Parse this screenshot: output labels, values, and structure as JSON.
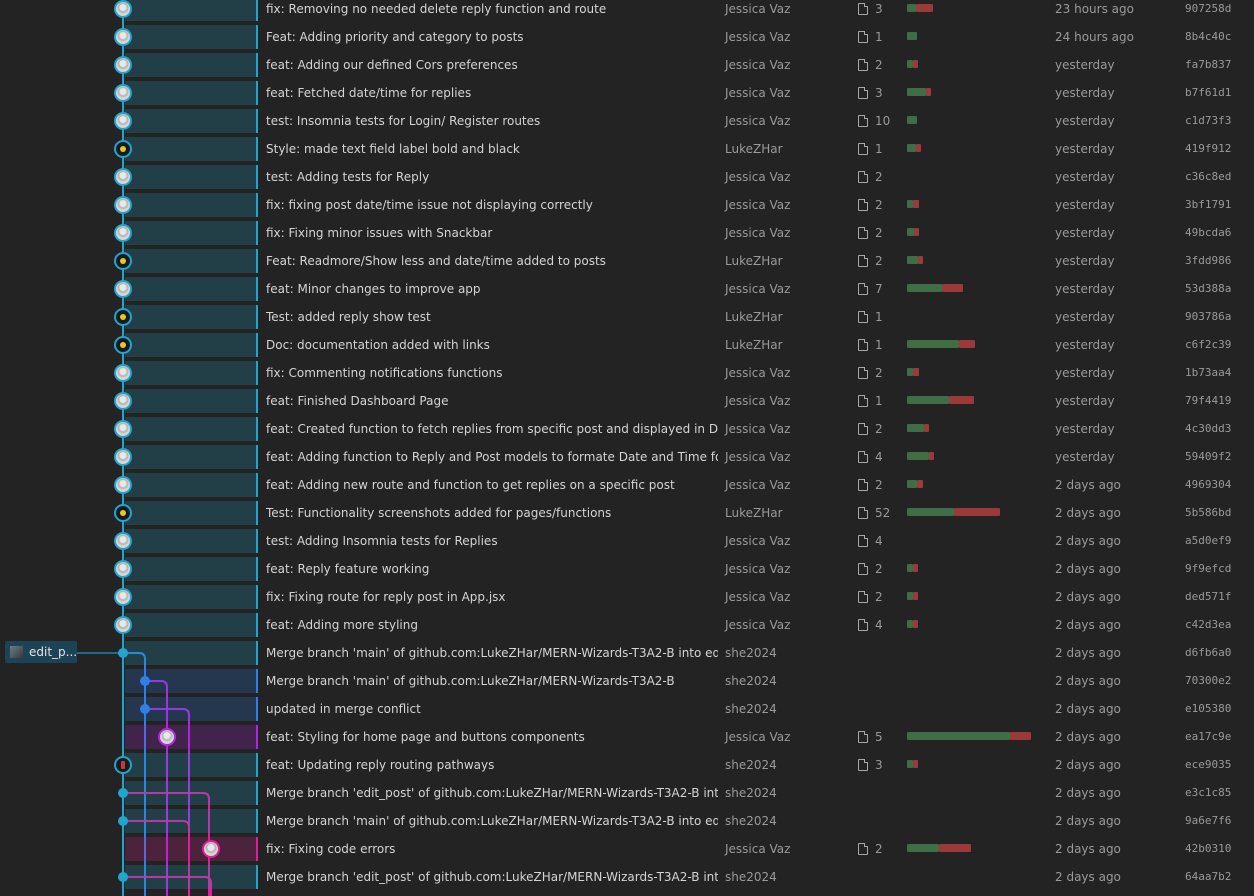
{
  "colors": {
    "lane_main": "#20a5ce",
    "lane_blue": "#2e7fe6",
    "lane_purple": "#b026e0",
    "lane_pink": "#de1e9b",
    "additions": "#3f6e46",
    "deletions": "#9a3a3a",
    "background": "#232323"
  },
  "branch_tag": {
    "label": "edit_p..."
  },
  "commits": [
    {
      "message": "fix: Removing no needed delete reply function and route",
      "author": "Jessica Vaz",
      "files": "3",
      "add": 0.07,
      "del": 0.14,
      "date": "23 hours ago",
      "sha": "907258d",
      "avatar": "photo",
      "lane": 0
    },
    {
      "message": "Feat: Adding priority and category to posts",
      "author": "Jessica Vaz",
      "files": "1",
      "add": 0.08,
      "del": 0,
      "date": "24 hours ago",
      "sha": "8b4c40c",
      "avatar": "photo",
      "lane": 0
    },
    {
      "message": "feat: Adding our defined Cors preferences",
      "author": "Jessica Vaz",
      "files": "2",
      "add": 0.05,
      "del": 0.04,
      "date": "yesterday",
      "sha": "fa7b837",
      "avatar": "photo",
      "lane": 0
    },
    {
      "message": "feat: Fetched date/time for replies",
      "author": "Jessica Vaz",
      "files": "3",
      "add": 0.15,
      "del": 0.04,
      "date": "yesterday",
      "sha": "b7f61d1",
      "avatar": "photo",
      "lane": 0
    },
    {
      "message": "test: Insomnia tests for Login/ Register routes",
      "author": "Jessica Vaz",
      "files": "10",
      "add": 0.08,
      "del": 0,
      "date": "yesterday",
      "sha": "c1d73f3",
      "avatar": "photo",
      "lane": 0
    },
    {
      "message": "Style: made text field label bold and black",
      "author": "LukeZHar",
      "files": "1",
      "add": 0.07,
      "del": 0.04,
      "date": "yesterday",
      "sha": "419f912",
      "avatar": "emoji",
      "lane": 0
    },
    {
      "message": "test: Adding tests for Reply",
      "author": "Jessica Vaz",
      "files": "2",
      "add": 0,
      "del": 0,
      "date": "yesterday",
      "sha": "c36c8ed",
      "avatar": "photo",
      "lane": 0
    },
    {
      "message": "fix: fixing post date/time issue not displaying correctly",
      "author": "Jessica Vaz",
      "files": "2",
      "add": 0.05,
      "del": 0.05,
      "date": "yesterday",
      "sha": "3bf1791",
      "avatar": "photo",
      "lane": 0
    },
    {
      "message": "fix: Fixing minor issues with Snackbar",
      "author": "Jessica Vaz",
      "files": "2",
      "add": 0.06,
      "del": 0.04,
      "date": "yesterday",
      "sha": "49bcda6",
      "avatar": "photo",
      "lane": 0
    },
    {
      "message": "Feat: Readmore/Show less and date/time added to posts",
      "author": "LukeZHar",
      "files": "2",
      "add": 0.09,
      "del": 0.04,
      "date": "yesterday",
      "sha": "3fdd986",
      "avatar": "emoji",
      "lane": 0
    },
    {
      "message": "feat: Minor changes to improve app",
      "author": "Jessica Vaz",
      "files": "7",
      "add": 0.28,
      "del": 0.17,
      "date": "yesterday",
      "sha": "53d388a",
      "avatar": "photo",
      "lane": 0
    },
    {
      "message": "Test: added reply show test",
      "author": "LukeZHar",
      "files": "1",
      "add": 0,
      "del": 0,
      "date": "yesterday",
      "sha": "903786a",
      "avatar": "emoji",
      "lane": 0
    },
    {
      "message": "Doc: documentation added with links",
      "author": "LukeZHar",
      "files": "1",
      "add": 0.42,
      "del": 0.13,
      "date": "yesterday",
      "sha": "c6f2c39",
      "avatar": "emoji",
      "lane": 0
    },
    {
      "message": "fix: Commenting notifications functions",
      "author": "Jessica Vaz",
      "files": "2",
      "add": 0.05,
      "del": 0.05,
      "date": "yesterday",
      "sha": "1b73aa4",
      "avatar": "photo",
      "lane": 0
    },
    {
      "message": "feat: Finished Dashboard Page",
      "author": "Jessica Vaz",
      "files": "1",
      "add": 0.34,
      "del": 0.2,
      "date": "yesterday",
      "sha": "79f4419",
      "avatar": "photo",
      "lane": 0
    },
    {
      "message": "feat: Created function to fetch replies from specific post and displayed in Dashboard",
      "author": "Jessica Vaz",
      "files": "2",
      "add": 0.14,
      "del": 0.04,
      "date": "yesterday",
      "sha": "4c30dd3",
      "avatar": "photo",
      "lane": 0
    },
    {
      "message": "feat: Adding function to Reply and Post models to formate Date and Time for readability",
      "author": "Jessica Vaz",
      "files": "4",
      "add": 0.18,
      "del": 0.04,
      "date": "yesterday",
      "sha": "59409f2",
      "avatar": "photo",
      "lane": 0
    },
    {
      "message": "feat: Adding new route and function to get replies on a specific post",
      "author": "Jessica Vaz",
      "files": "2",
      "add": 0.08,
      "del": 0.05,
      "date": "2 days ago",
      "sha": "4969304",
      "avatar": "photo",
      "lane": 0
    },
    {
      "message": "Test: Functionality screenshots added for pages/functions",
      "author": "LukeZHar",
      "files": "52",
      "add": 0.38,
      "del": 0.37,
      "date": "2 days ago",
      "sha": "5b586bd",
      "avatar": "emoji",
      "lane": 0
    },
    {
      "message": "test: Adding Insomnia tests for Replies",
      "author": "Jessica Vaz",
      "files": "4",
      "add": 0,
      "del": 0,
      "date": "2 days ago",
      "sha": "a5d0ef9",
      "avatar": "photo",
      "lane": 0
    },
    {
      "message": "feat: Reply feature working",
      "author": "Jessica Vaz",
      "files": "2",
      "add": 0.05,
      "del": 0.04,
      "date": "2 days ago",
      "sha": "9f9efcd",
      "avatar": "photo",
      "lane": 0
    },
    {
      "message": "fix: Fixing route for reply post in App.jsx",
      "author": "Jessica Vaz",
      "files": "2",
      "add": 0.05,
      "del": 0.04,
      "date": "2 days ago",
      "sha": "ded571f",
      "avatar": "photo",
      "lane": 0
    },
    {
      "message": "feat: Adding more styling",
      "author": "Jessica Vaz",
      "files": "4",
      "add": 0.05,
      "del": 0.04,
      "date": "2 days ago",
      "sha": "c42d3ea",
      "avatar": "photo",
      "lane": 0
    },
    {
      "message": "Merge branch 'main' of github.com:LukeZHar/MERN-Wizards-T3A2-B into edit_post",
      "author": "she2024",
      "files": "",
      "add": 0,
      "del": 0,
      "date": "2 days ago",
      "sha": "d6fb6a0",
      "avatar": "dot",
      "lane": 0
    },
    {
      "message": "Merge branch 'main' of github.com:LukeZHar/MERN-Wizards-T3A2-B",
      "author": "she2024",
      "files": "",
      "add": 0,
      "del": 0,
      "date": "2 days ago",
      "sha": "70300e2",
      "avatar": "dot",
      "lane": 1
    },
    {
      "message": "updated in merge conflict",
      "author": "she2024",
      "files": "",
      "add": 0,
      "del": 0,
      "date": "2 days ago",
      "sha": "e105380",
      "avatar": "dot",
      "lane": 1
    },
    {
      "message": "feat: Styling for home page and buttons components",
      "author": "Jessica Vaz",
      "files": "5",
      "add": 0.83,
      "del": 0.17,
      "date": "2 days ago",
      "sha": "ea17c9e",
      "avatar": "photo",
      "lane": 2
    },
    {
      "message": "feat: Updating reply routing pathways",
      "author": "she2024",
      "files": "3",
      "add": 0.05,
      "del": 0.04,
      "date": "2 days ago",
      "sha": "ece9035",
      "avatar": "robot",
      "lane": 0
    },
    {
      "message": "Merge branch 'edit_post' of github.com:LukeZHar/MERN-Wizards-T3A2-B into edit_post",
      "author": "she2024",
      "files": "",
      "add": 0,
      "del": 0,
      "date": "2 days ago",
      "sha": "e3c1c85",
      "avatar": "dot",
      "lane": 0
    },
    {
      "message": "Merge branch 'main' of github.com:LukeZHar/MERN-Wizards-T3A2-B into edit_post",
      "author": "she2024",
      "files": "",
      "add": 0,
      "del": 0,
      "date": "2 days ago",
      "sha": "9a6e7f6",
      "avatar": "dot",
      "lane": 0
    },
    {
      "message": "fix: Fixing code errors",
      "author": "Jessica Vaz",
      "files": "2",
      "add": 0.26,
      "del": 0.26,
      "date": "2 days ago",
      "sha": "42b0310",
      "avatar": "photo",
      "lane": 3
    },
    {
      "message": "Merge branch 'edit_post' of github.com:LukeZHar/MERN-Wizards-T3A2-B into edit_post",
      "author": "she2024",
      "files": "",
      "add": 0,
      "del": 0,
      "date": "2 days ago",
      "sha": "64aa7b2",
      "avatar": "dot",
      "lane": 0
    }
  ]
}
